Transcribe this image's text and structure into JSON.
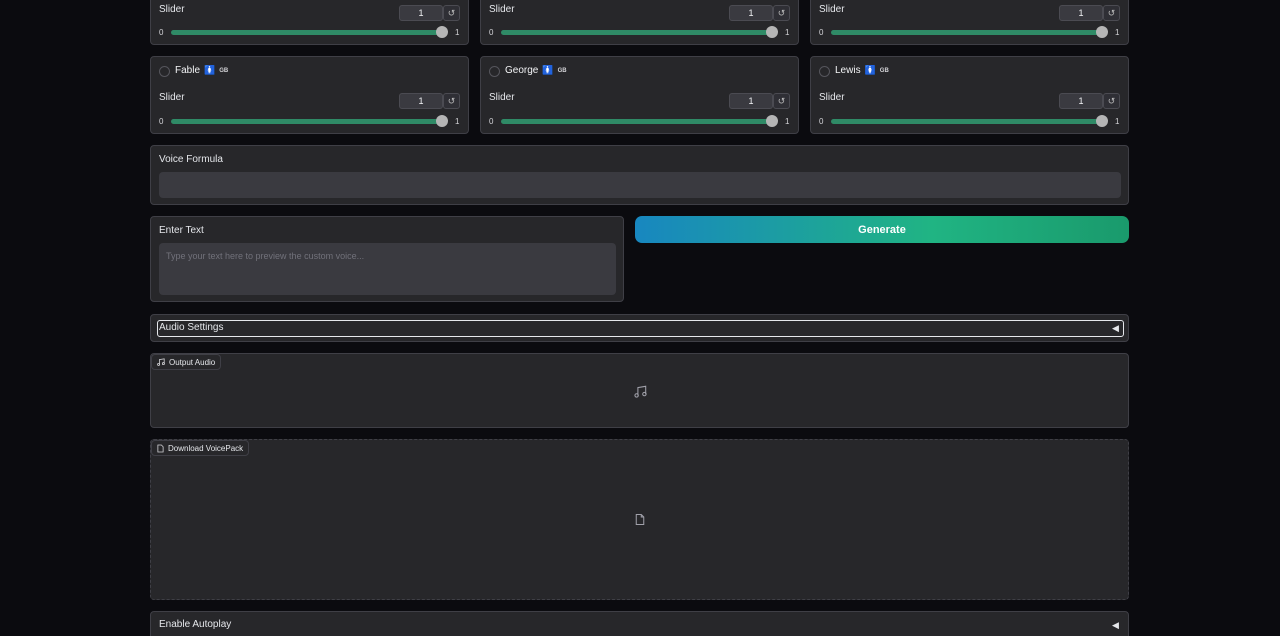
{
  "voices_top": [
    {
      "slider_label": "Slider",
      "value": "1",
      "min": "0",
      "max": "1",
      "level": 1.0
    },
    {
      "slider_label": "Slider",
      "value": "1",
      "min": "0",
      "max": "1",
      "level": 1.0
    },
    {
      "slider_label": "Slider",
      "value": "1",
      "min": "0",
      "max": "1",
      "level": 1.0
    }
  ],
  "voices": [
    {
      "name": "Fable",
      "region": "GB",
      "slider_label": "Slider",
      "value": "1",
      "min": "0",
      "max": "1",
      "level": 1.0
    },
    {
      "name": "George",
      "region": "GB",
      "slider_label": "Slider",
      "value": "1",
      "min": "0",
      "max": "1",
      "level": 1.0
    },
    {
      "name": "Lewis",
      "region": "GB",
      "slider_label": "Slider",
      "value": "1",
      "min": "0",
      "max": "1",
      "level": 1.0
    }
  ],
  "reset_glyph": "↺",
  "formula": {
    "label": "Voice Formula",
    "value": ""
  },
  "text_input": {
    "label": "Enter Text",
    "placeholder": "Type your text here to preview the custom voice..."
  },
  "generate": {
    "label": "Generate"
  },
  "audio_settings": {
    "label": "Audio Settings",
    "arrow": "◀"
  },
  "output_audio": {
    "label": "Output Audio",
    "icon": "music-note-icon"
  },
  "download": {
    "label": "Download VoicePack",
    "icon": "file-icon"
  },
  "autoplay": {
    "label": "Enable Autoplay",
    "arrow": "◀"
  },
  "colors": {
    "accent_start": "#1887c0",
    "accent_end": "#20b483",
    "slider": "#2f8a66",
    "panel": "#27272a",
    "background": "#0b0b0f"
  }
}
